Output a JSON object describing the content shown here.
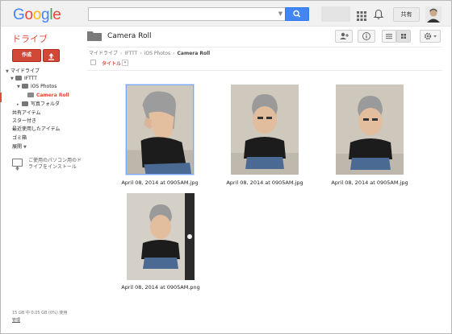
{
  "header": {
    "logo": "Google",
    "share_label": "共有"
  },
  "sidebar": {
    "drive_title": "ドライブ",
    "create_label": "作成",
    "tree": [
      {
        "label": "マイドライブ",
        "expanded": true
      },
      {
        "label": "IFTTT",
        "expanded": true
      },
      {
        "label": "iOS Photos",
        "expanded": true
      },
      {
        "label": "Camera Roll",
        "selected": true
      },
      {
        "label": "写真フォルダ"
      },
      {
        "label": "共有アイテム"
      },
      {
        "label": "スター付き"
      },
      {
        "label": "最近使用したアイテム"
      },
      {
        "label": "ゴミ箱"
      },
      {
        "label": "展開"
      }
    ],
    "install_text": "ご使用のパソコン用のドライブをインストール",
    "storage_text": "15 GB 中 0.05 GB (0%) 使用",
    "manage_label": "管理"
  },
  "main": {
    "folder_title": "Camera Roll",
    "breadcrumb": [
      "マイドライブ",
      "IFTTT",
      "iOS Photos",
      "Camera Roll"
    ],
    "column_title": "タイトル",
    "files": [
      {
        "name": "April 08, 2014 at 0905AM.jpg"
      },
      {
        "name": "April 08, 2014 at 0905AM.jpg"
      },
      {
        "name": "April 08, 2014 at 0905AM.jpg"
      },
      {
        "name": "April 08, 2014 at 0905AM.png"
      }
    ]
  },
  "colors": {
    "accent_red": "#dd4b39",
    "create_button": "#d14836",
    "search_blue": "#4285f4"
  }
}
